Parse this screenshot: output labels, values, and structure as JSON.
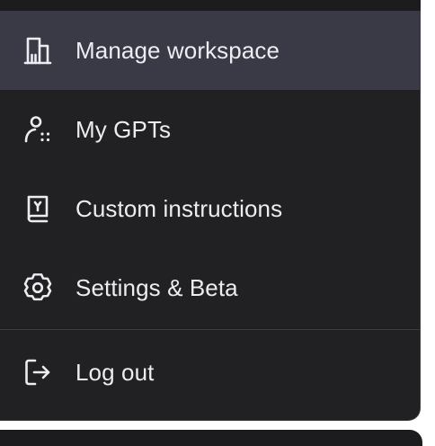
{
  "menu": {
    "items": [
      {
        "label": "Manage workspace",
        "icon": "building-icon",
        "active": true
      },
      {
        "label": "My GPTs",
        "icon": "user-grid-icon",
        "active": false
      },
      {
        "label": "Custom instructions",
        "icon": "book-icon",
        "active": false
      },
      {
        "label": "Settings & Beta",
        "icon": "gear-icon",
        "active": false
      }
    ],
    "logout": {
      "label": "Log out",
      "icon": "logout-icon"
    }
  },
  "colors": {
    "panel_bg": "#212124",
    "active_bg": "#3a3a46",
    "text": "#ececf1",
    "divider": "#3c3c42"
  }
}
